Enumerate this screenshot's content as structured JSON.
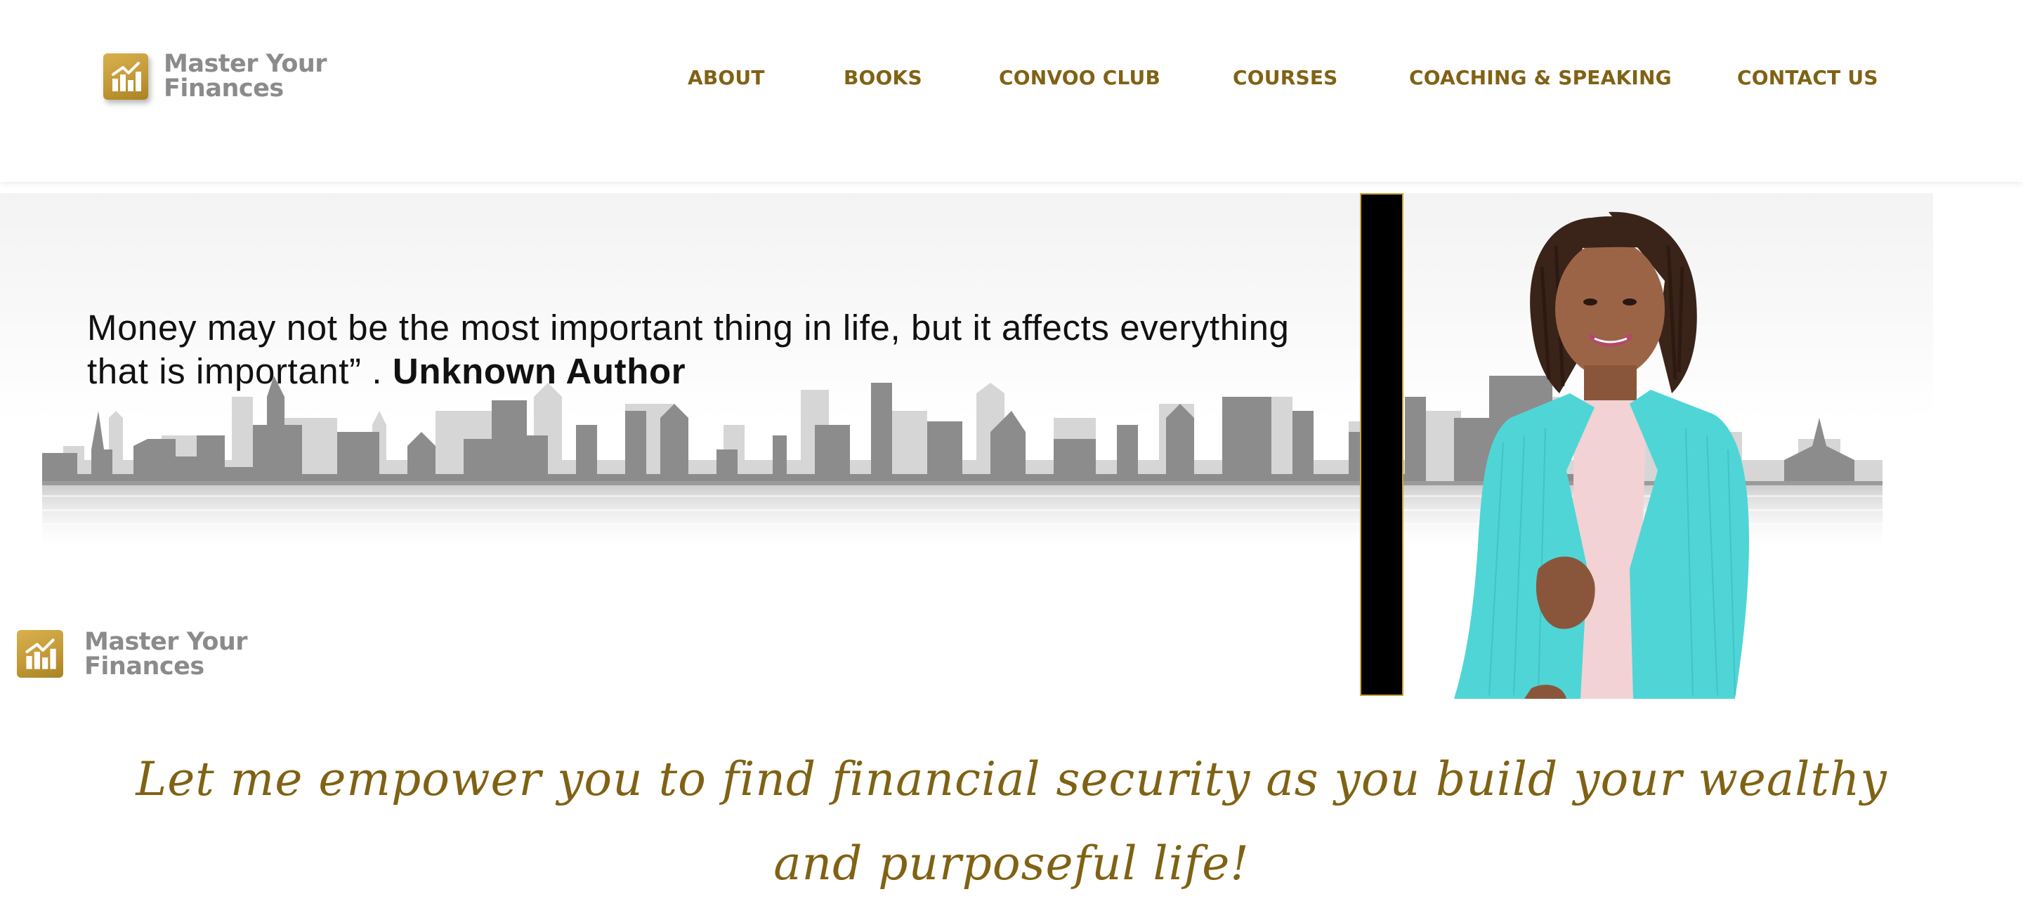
{
  "brand": {
    "line1": "Master Your",
    "line2": "Finances",
    "color": "#c39a37"
  },
  "nav": {
    "items": [
      "ABOUT",
      "BOOKS",
      "CONVOO CLUB",
      "COURSES",
      "COACHING & SPEAKING",
      "CONTACT US"
    ],
    "color": "#806214"
  },
  "hero": {
    "quote_text": "Money may not be the most important thing in life, but it affects everything that is important” . ",
    "quote_author": "Unknown Author"
  },
  "tagline": {
    "line1": "Let me empower you to find financial security as you build your wealthy",
    "line2": "and purposeful life!"
  }
}
